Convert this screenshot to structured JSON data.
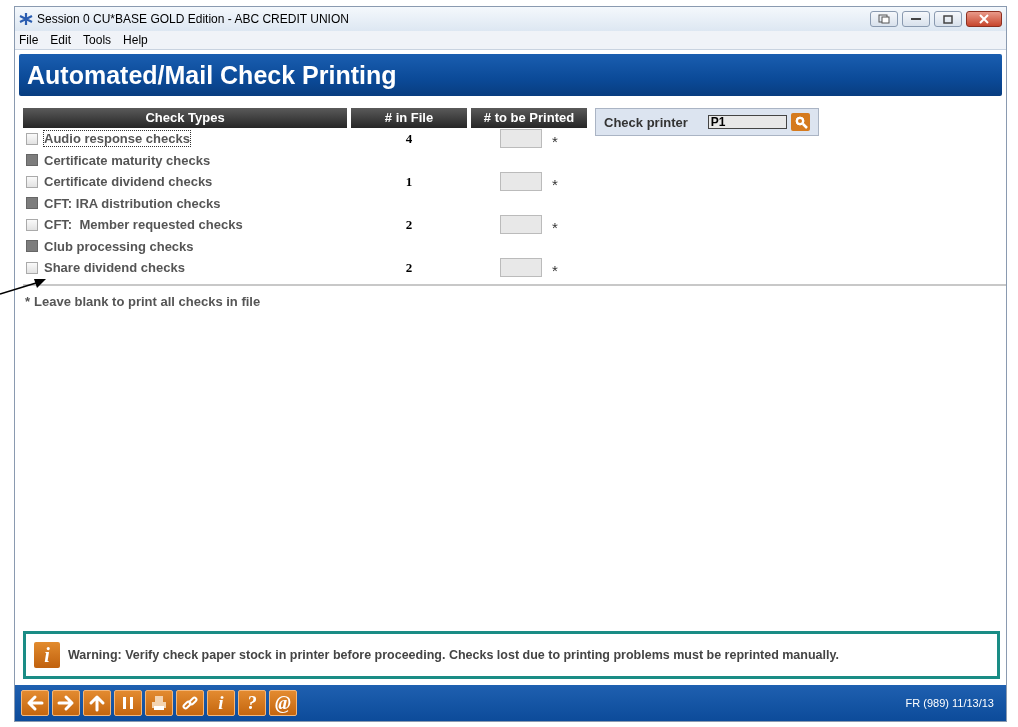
{
  "window": {
    "title": "Session 0 CU*BASE GOLD Edition - ABC CREDIT UNION"
  },
  "menu": [
    "File",
    "Edit",
    "Tools",
    "Help"
  ],
  "header": {
    "title": "Automated/Mail Check Printing"
  },
  "table": {
    "columns": [
      "Check Types",
      "# in File",
      "# to be Printed"
    ],
    "rows": [
      {
        "label": "Audio response checks",
        "disabled": false,
        "focused": true,
        "in_file": "4",
        "has_field": true,
        "mark": "*"
      },
      {
        "label": "Certificate maturity checks",
        "disabled": true,
        "focused": false,
        "has_field": false
      },
      {
        "label": "Certificate dividend checks",
        "disabled": false,
        "focused": false,
        "in_file": "1",
        "has_field": true,
        "mark": "*"
      },
      {
        "label": "CFT: IRA distribution checks",
        "disabled": true,
        "focused": false,
        "has_field": false
      },
      {
        "label": "CFT:  Member requested checks",
        "disabled": false,
        "focused": false,
        "in_file": "2",
        "has_field": true,
        "mark": "*"
      },
      {
        "label": "Club processing checks",
        "disabled": true,
        "focused": false,
        "has_field": false
      },
      {
        "label": "Share dividend checks",
        "disabled": false,
        "focused": false,
        "in_file": "2",
        "has_field": true,
        "mark": "*"
      }
    ]
  },
  "printer": {
    "label": "Check printer",
    "value": "P1"
  },
  "footnote": {
    "mark": "*",
    "text": "Leave blank to print all checks in file"
  },
  "warning": {
    "icon": "i",
    "text": "Warning: Verify check paper stock in printer before proceeding. Checks lost due to printing problems must be reprinted manually."
  },
  "toolbar": [
    {
      "kind": "left"
    },
    {
      "kind": "right"
    },
    {
      "kind": "up"
    },
    {
      "kind": "pause"
    },
    {
      "kind": "print"
    },
    {
      "kind": "link"
    },
    {
      "kind": "glyph",
      "glyph": "i"
    },
    {
      "kind": "glyph",
      "glyph": "?"
    },
    {
      "kind": "glyph",
      "glyph": "@"
    }
  ],
  "status": "FR (989) 11/13/13"
}
